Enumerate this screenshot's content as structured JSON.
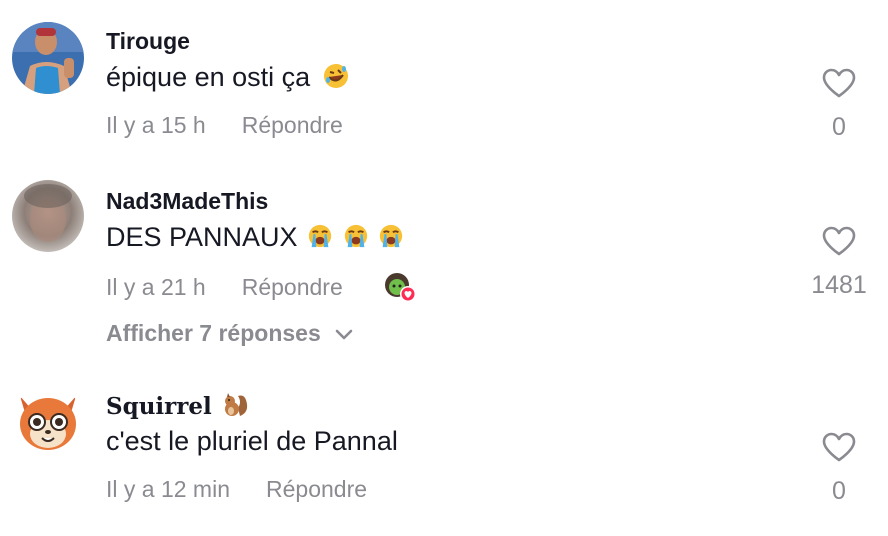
{
  "comments": [
    {
      "username": "Tirouge",
      "text": "épique en osti ça",
      "time": "Il y a 15 h",
      "reply_label": "Répondre",
      "likes": "0"
    },
    {
      "username": "Nad3MadeThis",
      "text": "DES PANNAUX",
      "time": "Il y a 21 h",
      "reply_label": "Répondre",
      "likes": "1481",
      "view_replies": "Afficher 7 réponses"
    },
    {
      "username": "Squirrel",
      "text": "c'est le pluriel de Pannal",
      "time": "Il y a 12 min",
      "reply_label": "Répondre",
      "likes": "0"
    }
  ],
  "colors": {
    "text": "#161823",
    "muted": "#8a8b91",
    "accent": "#fe2c55"
  },
  "icons": {
    "like": "heart-outline-icon",
    "expand": "chevron-down-icon",
    "laugh": "rolling-on-floor-laughing-emoji",
    "cry": "loudly-crying-emoji",
    "squirrel": "chipmunk-emoji",
    "creator_like": "creator-liked-badge"
  }
}
